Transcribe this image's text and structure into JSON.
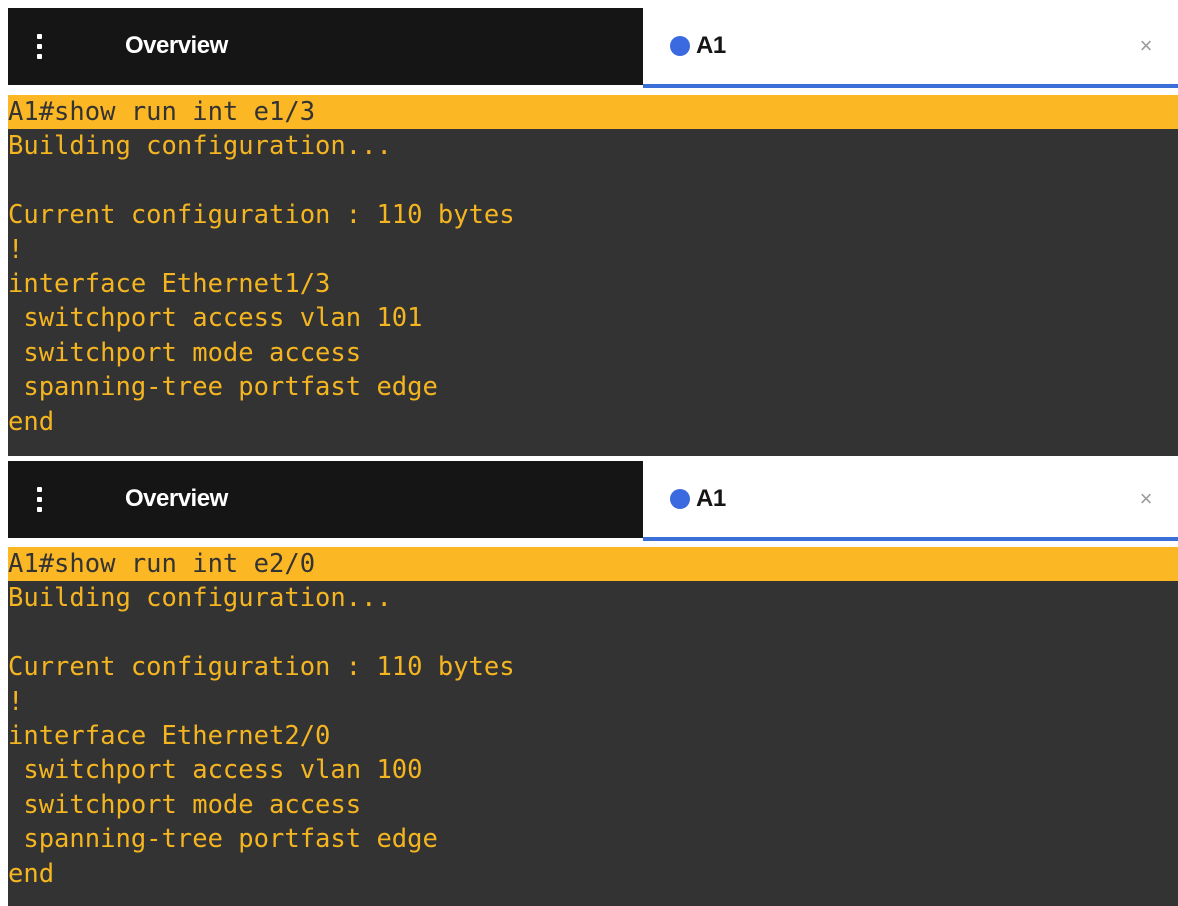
{
  "panes": [
    {
      "tabs": {
        "menu_icon": "kebab-menu-icon",
        "overview_label": "Overview",
        "active_label": "A1",
        "active_dot_color": "#3b69e0",
        "close_glyph": "×"
      },
      "terminal": {
        "lines": [
          "A1#show run int e1/3",
          "Building configuration...",
          "",
          "Current configuration : 110 bytes",
          "!",
          "interface Ethernet1/3",
          " switchport access vlan 101",
          " switchport mode access",
          " spanning-tree portfast edge",
          "end"
        ]
      }
    },
    {
      "tabs": {
        "menu_icon": "kebab-menu-icon",
        "overview_label": "Overview",
        "active_label": "A1",
        "active_dot_color": "#3b69e0",
        "close_glyph": "×"
      },
      "terminal": {
        "lines": [
          "A1#show run int e2/0",
          "Building configuration...",
          "",
          "Current configuration : 110 bytes",
          "!",
          "interface Ethernet2/0",
          " switchport access vlan 100",
          " switchport mode access",
          " spanning-tree portfast edge",
          "end"
        ]
      }
    }
  ],
  "colors": {
    "terminal_bg": "#333333",
    "terminal_text": "#f4b521",
    "command_highlight": "#fbb724",
    "tab_dark": "#151515",
    "tab_active_underline": "#3b6fd8"
  }
}
